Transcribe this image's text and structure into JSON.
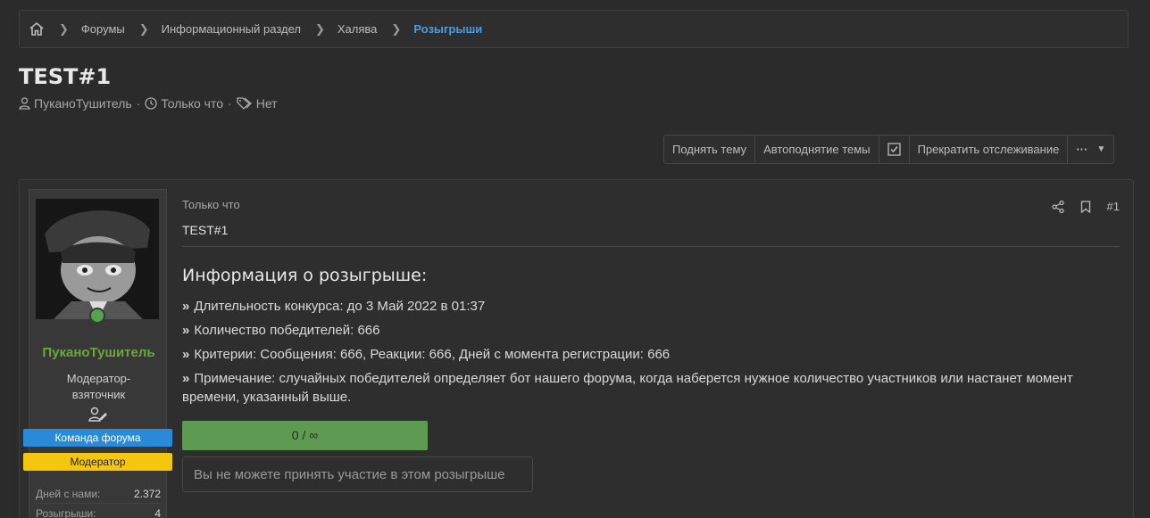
{
  "breadcrumb": {
    "items": [
      {
        "label": "Форумы"
      },
      {
        "label": "Информационный раздел"
      },
      {
        "label": "Халява"
      },
      {
        "label": "Розыгрыши"
      }
    ]
  },
  "thread": {
    "title": "TEST#1",
    "author": "ПуканоТушитель",
    "time": "Только что",
    "tags": "Нет"
  },
  "actions": {
    "bump": "Поднять тему",
    "autobump": "Автоподнятие темы",
    "unwatch": "Прекратить отслеживание",
    "more": "···"
  },
  "user": {
    "name": "ПуканоТушитель",
    "title_line1": "Модератор-",
    "title_line2": "взяточник",
    "banner_team": "Команда форума",
    "banner_mod": "Модератор",
    "stats": [
      {
        "label": "Дней с нами:",
        "value": "2.372"
      },
      {
        "label": "Розыгрыши:",
        "value": "4"
      }
    ],
    "colors": {
      "name": "#6aa83c",
      "online": "#57a24d",
      "team": "#2b8ad8",
      "mod": "#f4c60e"
    }
  },
  "post": {
    "time": "Только что",
    "number": "#1",
    "heading": "TEST#1",
    "info_title": "Информация о розыгрыше:",
    "info_rows": [
      "Длительность конкурса: до 3 Май 2022 в 01:37",
      "Количество победителей: 666",
      "Критерии: Сообщения: 666, Реакции: 666, Дней с момента регистрации: 666",
      "Примечание: случайных победителей определяет бот нашего форума, когда наберется нужное количество участников или настанет момент времени, указанный выше."
    ],
    "progress_text": "0 / ∞",
    "progress_fraction": 1.0,
    "participate_text": "Вы не можете принять участие в этом розыгрыше"
  },
  "theme": {
    "accent": "#4d9de0",
    "progress": "#5d9a52"
  }
}
